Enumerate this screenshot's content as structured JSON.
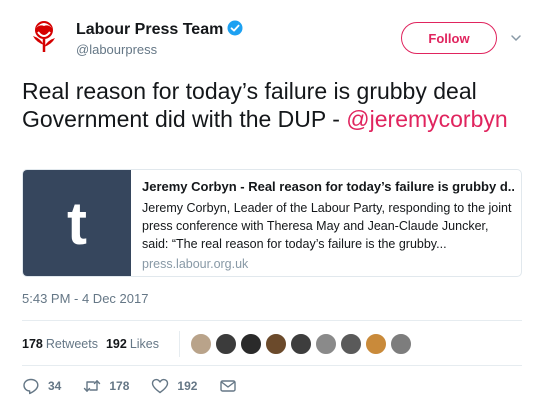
{
  "author": {
    "name": "Labour Press Team",
    "handle": "@labourpress",
    "brand_color": "#e0245e"
  },
  "follow_label": "Follow",
  "tweet": {
    "text": "Real reason for today’s failure is grubby deal Government did with the DUP - ",
    "mention": "@jeremycorbyn"
  },
  "card": {
    "thumb_letter": "t",
    "title": "Jeremy Corbyn - Real reason for today’s failure is grubby d...",
    "description": "Jeremy Corbyn, Leader of the Labour Party, responding to the joint press conference with Theresa May and Jean-Claude Juncker, said: “The real reason for today’s failure is the grubby...",
    "domain": "press.labour.org.uk"
  },
  "timestamp": "5:43 PM - 4 Dec 2017",
  "stats": {
    "retweets_count": "178",
    "retweets_label": "Retweets",
    "likes_count": "192",
    "likes_label": "Likes"
  },
  "actions": {
    "replies": "34",
    "retweets": "178",
    "likes": "192"
  },
  "likers": [
    "#b9a38a",
    "#3b3b3b",
    "#2a2a2a",
    "#6b4a2b",
    "#3d3d3d",
    "#8a8a8a",
    "#5a5a5a",
    "#c98a3a",
    "#7d7d7d"
  ]
}
